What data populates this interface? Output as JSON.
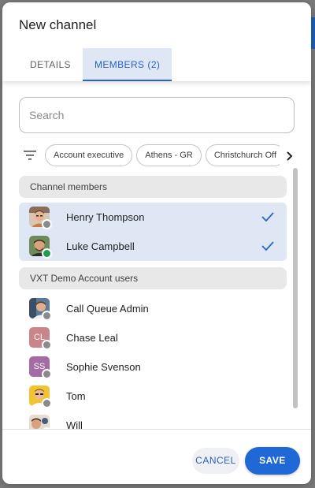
{
  "dialog": {
    "title": "New channel"
  },
  "tabs": [
    {
      "label": "DETAILS",
      "active": false
    },
    {
      "label": "MEMBERS",
      "count": "(2)",
      "active": true
    }
  ],
  "search": {
    "placeholder": "Search",
    "value": ""
  },
  "filters": {
    "icon": "filter-icon",
    "chips": [
      "Account executive",
      "Athens - GR",
      "Christchurch Off"
    ],
    "next_icon": "chevron-right-icon"
  },
  "sections": [
    {
      "title": "Channel members",
      "rows": [
        {
          "name": "Henry Thompson",
          "avatar": "photo",
          "status": "offline",
          "selected": true,
          "checked": true
        },
        {
          "name": "Luke Campbell",
          "avatar": "photo",
          "status": "online",
          "selected": true,
          "checked": true
        }
      ]
    },
    {
      "title": "VXT Demo Account users",
      "rows": [
        {
          "name": "Call Queue Admin",
          "avatar": "photo",
          "status": "offline"
        },
        {
          "name": "Chase Leal",
          "avatar_initials": "CL",
          "avatar_color": "#c9858a",
          "status": "offline"
        },
        {
          "name": "Sophie Svenson",
          "avatar_initials": "SS",
          "avatar_color": "#a36da3",
          "status": "offline"
        },
        {
          "name": "Tom",
          "avatar": "photo",
          "status": "offline"
        },
        {
          "name": "Will",
          "avatar": "photo",
          "status": "offline"
        }
      ]
    }
  ],
  "footer": {
    "cancel_label": "CANCEL",
    "save_label": "SAVE"
  },
  "colors": {
    "accent": "#2a63c6",
    "primary_button": "#1f68d6",
    "selected_row": "#dfe6f4",
    "online": "#1e9e4a",
    "offline": "#8a8a8a"
  }
}
